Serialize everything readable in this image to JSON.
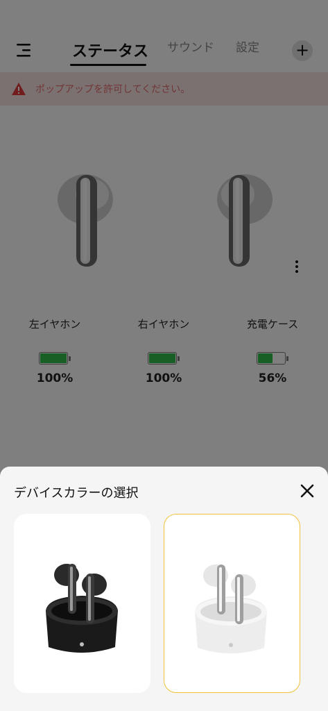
{
  "header": {
    "tabs": [
      {
        "label": "ステータス",
        "active": true
      },
      {
        "label": "サウンド",
        "active": false
      },
      {
        "label": "設定",
        "active": false
      }
    ],
    "add_label": "+",
    "menu_icon": "menu-icon"
  },
  "alert": {
    "icon": "warning-icon",
    "text": "ポップアップを許可してください。",
    "color": "#e26a6a"
  },
  "status": {
    "devices": [
      {
        "label": "左イヤホン",
        "battery_percent": 100,
        "battery_text": "100%"
      },
      {
        "label": "右イヤホン",
        "battery_percent": 100,
        "battery_text": "100%"
      },
      {
        "label": "充電ケース",
        "battery_percent": 56,
        "battery_text": "56%"
      }
    ],
    "battery_color": "#2fbf4a"
  },
  "sheet": {
    "title": "デバイスカラーの選択",
    "close_icon": "close-icon",
    "options": [
      {
        "color": "black",
        "selected": false
      },
      {
        "color": "white",
        "selected": true
      }
    ],
    "selected_border_color": "#f0c23c"
  }
}
